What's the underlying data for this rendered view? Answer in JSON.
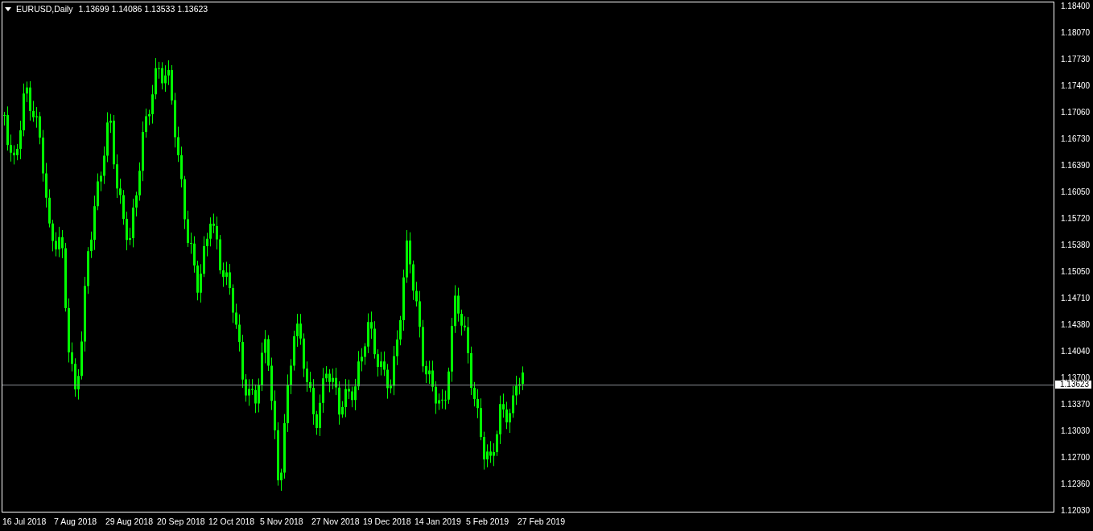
{
  "header": {
    "symbol": "EURUSD,Daily",
    "ohlc": "1.13699 1.14086 1.13533 1.13623"
  },
  "price_axis": {
    "labels": [
      "1.18400",
      "1.18070",
      "1.17730",
      "1.17400",
      "1.17060",
      "1.16730",
      "1.16390",
      "1.16050",
      "1.15720",
      "1.15380",
      "1.15050",
      "1.14710",
      "1.14380",
      "1.14040",
      "1.13700",
      "1.13370",
      "1.13030",
      "1.12700",
      "1.12360",
      "1.12030"
    ]
  },
  "current_price": "1.13623",
  "time_axis": {
    "labels": [
      "16 Jul 2018",
      "7 Aug 2018",
      "29 Aug 2018",
      "20 Sep 2018",
      "12 Oct 2018",
      "5 Nov 2018",
      "27 Nov 2018",
      "19 Dec 2018",
      "14 Jan 2019",
      "5 Feb 2019",
      "27 Feb 2019"
    ]
  }
}
